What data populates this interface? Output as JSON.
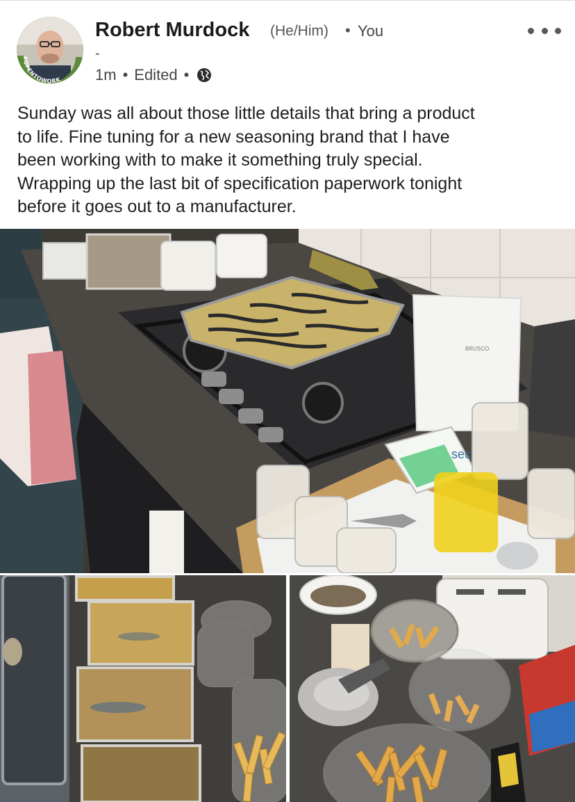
{
  "post": {
    "author": {
      "name": "Robert Murdock",
      "pronouns": "(He/Him)",
      "separator": "•",
      "relation": "You",
      "headline": "-",
      "badge_text": "#OPENTOWORK"
    },
    "meta": {
      "time": "1m",
      "dot1": "•",
      "edited": "Edited",
      "dot2": "•",
      "visibility_icon": "globe-icon"
    },
    "more_menu_icon": "ellipsis-icon",
    "text_lines": [
      "Sunday was all about those little details that bring a product",
      "to life. Fine tuning for a new seasoning brand that I have",
      "been working with to make it something truly special.",
      "Wrapping up the last bit of specification paperwork tonight",
      "before it goes out to a manufacturer."
    ],
    "images": {
      "main_label_bag": "BRUSCO",
      "main_label_cup": "sec"
    }
  },
  "colors": {
    "badge_green": "#5d8a3a",
    "seasoning_yellow": "#d8b24a",
    "text_primary": "#1d1d1d",
    "text_secondary": "#555555"
  }
}
